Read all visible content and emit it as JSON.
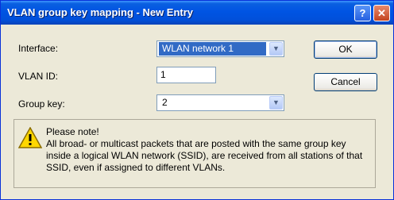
{
  "window": {
    "title": "VLAN group key mapping - New Entry",
    "help_label": "?",
    "close_label": "✕"
  },
  "form": {
    "interface_label": "Interface:",
    "interface_value": "WLAN network 1",
    "vlan_label": "VLAN ID:",
    "vlan_value": "1",
    "group_key_label": "Group key:",
    "group_key_value": "2"
  },
  "buttons": {
    "ok": "OK",
    "cancel": "Cancel"
  },
  "note": {
    "title": "Please note!",
    "text": "All broad- or multicast packets that are posted with the same group key inside a logical WLAN network (SSID), are received from all stations of that SSID, even if assigned to different VLANs."
  },
  "colors": {
    "titlebar": "#0054E3",
    "face": "#ECE9D8",
    "selection": "#316AC5",
    "border": "#7F9DB9"
  }
}
